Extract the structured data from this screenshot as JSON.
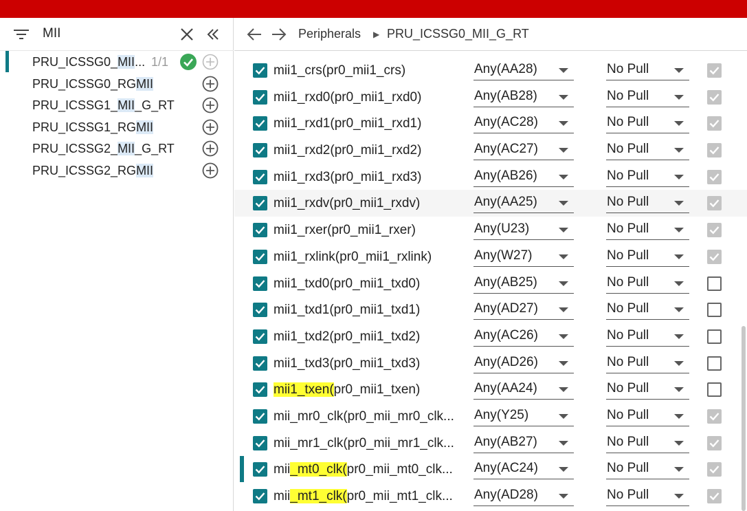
{
  "search": {
    "query": "MII"
  },
  "tree": [
    {
      "pre": "PRU_ICSSG0_",
      "hl": "MII",
      "post": "...",
      "count": "1/1",
      "status": "added",
      "selected": true
    },
    {
      "pre": "PRU_ICSSG0_RG",
      "hl": "MII",
      "post": "",
      "count": "",
      "status": "add",
      "selected": false
    },
    {
      "pre": "PRU_ICSSG1_",
      "hl": "MII",
      "post": "_G_RT",
      "count": "",
      "status": "add",
      "selected": false
    },
    {
      "pre": "PRU_ICSSG1_RG",
      "hl": "MII",
      "post": "",
      "count": "",
      "status": "add",
      "selected": false
    },
    {
      "pre": "PRU_ICSSG2_",
      "hl": "MII",
      "post": "_G_RT",
      "count": "",
      "status": "add",
      "selected": false
    },
    {
      "pre": "PRU_ICSSG2_RG",
      "hl": "MII",
      "post": "",
      "count": "",
      "status": "add",
      "selected": false
    }
  ],
  "breadcrumb": {
    "root": "Peripherals",
    "current": "PRU_ICSSG0_MII_G_RT"
  },
  "signals": [
    {
      "pre": "",
      "hl": "",
      "post": "mii1_crs(pr0_mii1_crs)",
      "pin": "Any(AA28)",
      "pull": "No Pull",
      "end_checked": true
    },
    {
      "pre": "",
      "hl": "",
      "post": "mii1_rxd0(pr0_mii1_rxd0)",
      "pin": "Any(AB28)",
      "pull": "No Pull",
      "end_checked": true
    },
    {
      "pre": "",
      "hl": "",
      "post": "mii1_rxd1(pr0_mii1_rxd1)",
      "pin": "Any(AC28)",
      "pull": "No Pull",
      "end_checked": true
    },
    {
      "pre": "",
      "hl": "",
      "post": "mii1_rxd2(pr0_mii1_rxd2)",
      "pin": "Any(AC27)",
      "pull": "No Pull",
      "end_checked": true
    },
    {
      "pre": "",
      "hl": "",
      "post": "mii1_rxd3(pr0_mii1_rxd3)",
      "pin": "Any(AB26)",
      "pull": "No Pull",
      "end_checked": true
    },
    {
      "pre": "",
      "hl": "",
      "post": "mii1_rxdv(pr0_mii1_rxdv)",
      "pin": "Any(AA25)",
      "pull": "No Pull",
      "end_checked": true,
      "hover": true
    },
    {
      "pre": "",
      "hl": "",
      "post": "mii1_rxer(pr0_mii1_rxer)",
      "pin": "Any(U23)",
      "pull": "No Pull",
      "end_checked": true
    },
    {
      "pre": "",
      "hl": "",
      "post": "mii1_rxlink(pr0_mii1_rxlink)",
      "pin": "Any(W27)",
      "pull": "No Pull",
      "end_checked": true
    },
    {
      "pre": "",
      "hl": "",
      "post": "mii1_txd0(pr0_mii1_txd0)",
      "pin": "Any(AB25)",
      "pull": "No Pull",
      "end_checked": false
    },
    {
      "pre": "",
      "hl": "",
      "post": "mii1_txd1(pr0_mii1_txd1)",
      "pin": "Any(AD27)",
      "pull": "No Pull",
      "end_checked": false
    },
    {
      "pre": "",
      "hl": "",
      "post": "mii1_txd2(pr0_mii1_txd2)",
      "pin": "Any(AC26)",
      "pull": "No Pull",
      "end_checked": false
    },
    {
      "pre": "",
      "hl": "",
      "post": "mii1_txd3(pr0_mii1_txd3)",
      "pin": "Any(AD26)",
      "pull": "No Pull",
      "end_checked": false
    },
    {
      "pre": "",
      "hl": "mii1_txen(",
      "post": "pr0_mii1_txen)",
      "pin": "Any(AA24)",
      "pull": "No Pull",
      "end_checked": false
    },
    {
      "pre": "",
      "hl": "",
      "post": "mii_mr0_clk(pr0_mii_mr0_clk...",
      "pin": "Any(Y25)",
      "pull": "No Pull",
      "end_checked": true
    },
    {
      "pre": "",
      "hl": "",
      "post": "mii_mr1_clk(pr0_mii_mr1_clk...",
      "pin": "Any(AB27)",
      "pull": "No Pull",
      "end_checked": true
    },
    {
      "pre": "mii",
      "hl": "_mt0_clk(",
      "post": "pr0_mii_mt0_clk...",
      "pin": "Any(AC24)",
      "pull": "No Pull",
      "end_checked": true,
      "marker": true
    },
    {
      "pre": "mii",
      "hl": "_mt1_clk(",
      "post": "pr0_mii_mt1_clk...",
      "pin": "Any(AD28)",
      "pull": "No Pull",
      "end_checked": true
    }
  ],
  "colors": {
    "brand_red": "#cc0000",
    "teal": "#0f7a85",
    "success": "#3aa757",
    "highlight": "#ffff33"
  }
}
